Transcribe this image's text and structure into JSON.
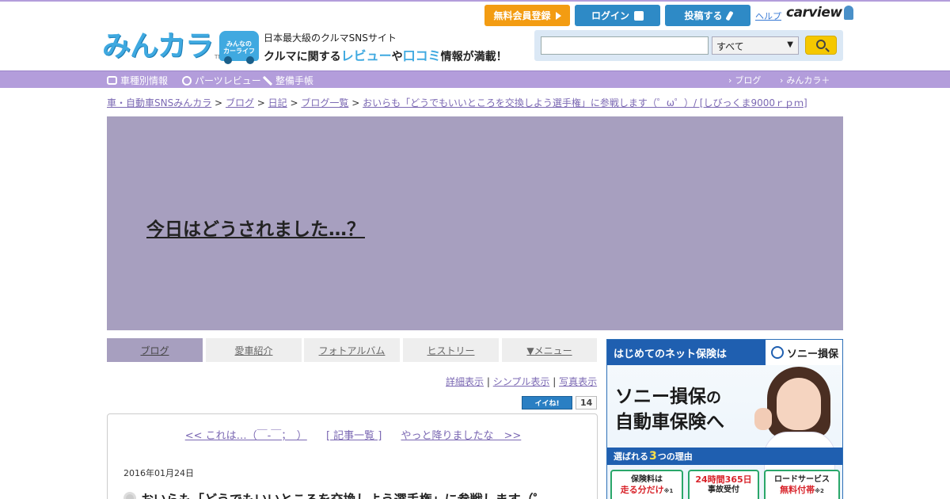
{
  "header": {
    "logo": "みんカラ",
    "logo_tm": "TM",
    "badge_text": "みんなの\nカーライフ",
    "tagline_top": "日本最大級のクルマSNSサイト",
    "tagline_a": "クルマに関する",
    "tagline_b": "レビュー",
    "tagline_c": "や",
    "tagline_d": "口コミ",
    "tagline_e": "情報が満載！",
    "register_label": "無料会員登録",
    "login_label": "ログイン",
    "post_label": "投稿する",
    "help_label": "ヘルプ",
    "carview_label": "carview",
    "search_placeholder": "",
    "search_scope": "すべて",
    "colors": {
      "accent": "#b39ddb",
      "brand_blue": "#3fa9e0",
      "register_orange": "#f39c12",
      "search_yellow": "#f5c800"
    }
  },
  "nav": {
    "items": [
      {
        "label": "車種別情報",
        "icon": "car-icon"
      },
      {
        "label": "パーツレビュー",
        "icon": "parts-icon"
      },
      {
        "label": "整備手帳",
        "icon": "wrench-icon"
      }
    ],
    "right": [
      {
        "label": "ブログ"
      },
      {
        "label": "みんカラ＋"
      }
    ]
  },
  "breadcrumb": {
    "items": [
      "車・自動車SNSみんカラ",
      "ブログ",
      "日記",
      "ブログ一覧",
      "おいらも「どうでもいいところを交換しよう選手権」に参戦します（゜ω゜）/ [しびっくま9000ｒｐｍ]"
    ],
    "separator": ">"
  },
  "hero": {
    "title": "今日はどうされました…？",
    "bg": "#a79fbf"
  },
  "tabs": [
    {
      "label": "ブログ",
      "active": true
    },
    {
      "label": "愛車紹介",
      "active": false
    },
    {
      "label": "フォトアルバム",
      "active": false
    },
    {
      "label": "ヒストリー",
      "active": false
    },
    {
      "label": "▼メニュー",
      "active": false
    }
  ],
  "view_links": {
    "detail": "詳細表示",
    "simple": "シンプル表示",
    "photo": "写真表示",
    "sep": "|"
  },
  "iine": {
    "label": "イイね!",
    "count": "14"
  },
  "article": {
    "prev": "<< これは…（￣-￣；　）",
    "list": "[ 記事一覧 ]",
    "next": "やっと降りましたな　>>",
    "date": "2016年01月24日",
    "title": "おいらも「どうでもいいところを交換しよう選手権」に参戦します（゜"
  },
  "ad": {
    "head": "はじめてのネット保険は",
    "brand": "ソニー損保",
    "copy1a": "ソニー損保",
    "copy1b": "の",
    "copy2": "自動車保険へ",
    "reason_a": "選ばれる",
    "reason_num": "3",
    "reason_b": "つの理由",
    "cards": [
      {
        "top": "保険料は",
        "main": "走る分だけ",
        "note": "※1"
      },
      {
        "top": "24時間365日",
        "main": "事故受付",
        "note": ""
      },
      {
        "top": "ロードサービス",
        "main": "無料付帯",
        "note": "※2"
      }
    ]
  }
}
